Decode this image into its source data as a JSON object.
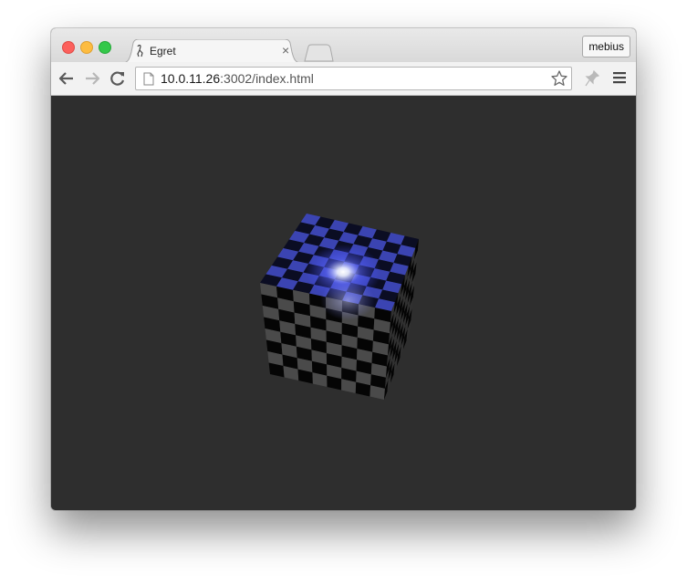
{
  "window": {
    "controls": {
      "close": "close-icon",
      "minimize": "minimize-icon",
      "maximize": "maximize-icon"
    }
  },
  "tabs": [
    {
      "title": "Egret",
      "favicon": "egret-favicon-icon",
      "close_glyph": "×"
    }
  ],
  "profile": {
    "label": "mebius"
  },
  "toolbar": {
    "back_icon": "back-arrow-icon",
    "forward_icon": "forward-arrow-icon",
    "reload_icon": "reload-icon",
    "url_host": "10.0.11.26",
    "url_rest": ":3002/index.html",
    "bookmark_icon": "star-icon",
    "extension_icon": "extension-pin-icon",
    "menu_icon": "hamburger-menu-icon"
  },
  "content": {
    "scene": "checkerboard-cube",
    "background_color": "#2e2e2e",
    "light_color": "#3a46ff",
    "checker_light": "#4a4a4a",
    "checker_dark": "#050505"
  }
}
